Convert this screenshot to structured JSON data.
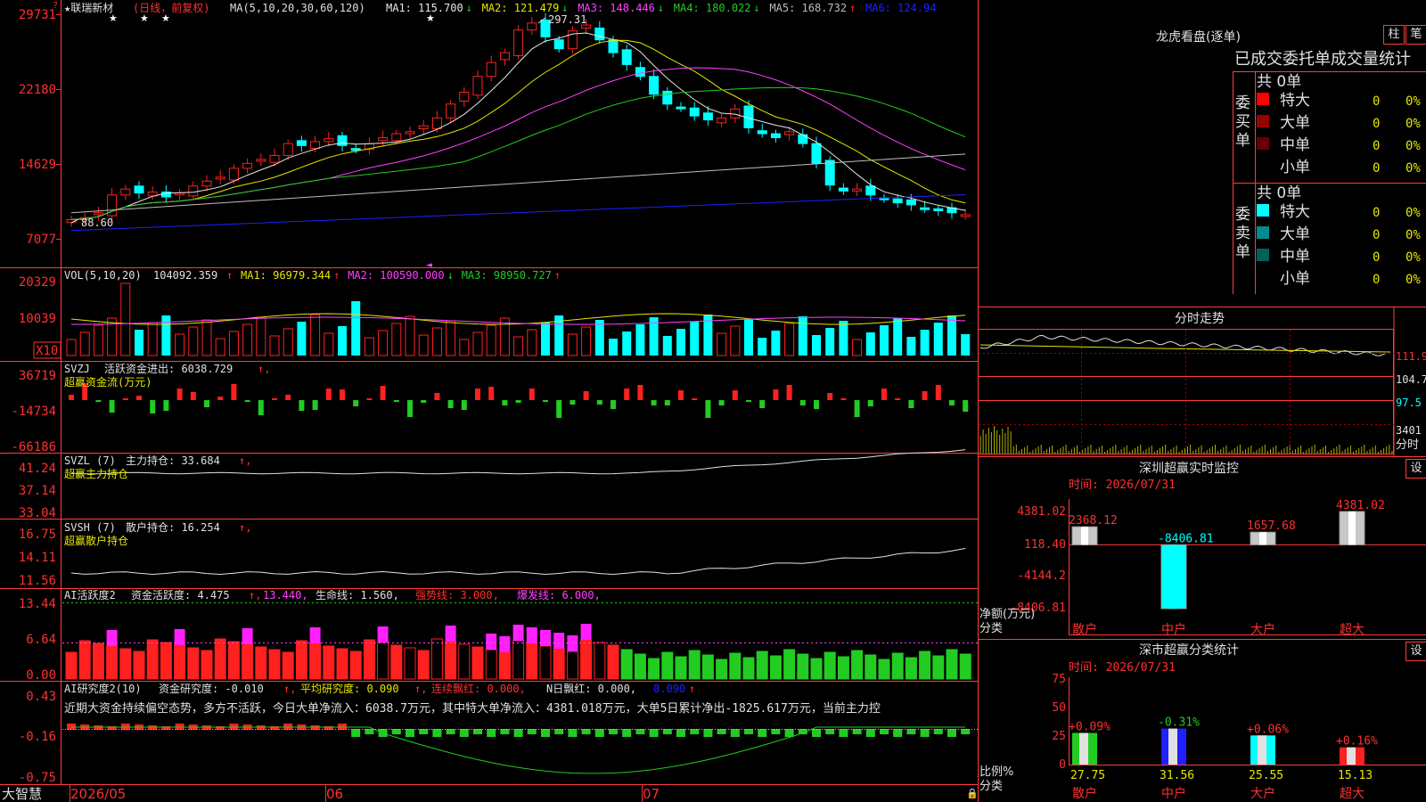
{
  "colors": {
    "up": "#ff2020",
    "down": "#00ffff",
    "grid": "#c00000",
    "axis": "#ff3c3c",
    "label_red": "#ff3030",
    "ma1": "#e6e6e6",
    "ma2": "#e6e600",
    "ma3": "#ff40ff",
    "ma4": "#22cc22",
    "ma5": "#bdbdbd",
    "ma6": "#2020ff"
  },
  "price_panel": {
    "axis_labels": [
      "29731",
      "22180",
      "14629",
      "7077"
    ],
    "markers": [
      "★",
      "★",
      "★",
      "★"
    ],
    "stock_name": "★联瑞新材",
    "period": "(日线，前复权)",
    "ma_title": "MA(5,10,20,30,60,120)",
    "ma_values": [
      {
        "label": "MA1: 115.700",
        "arrow": "↓",
        "color": "#e6e6e6"
      },
      {
        "label": "MA2: 121.479",
        "arrow": "↓",
        "color": "#e6e600"
      },
      {
        "label": "MA3: 148.446",
        "arrow": "↓",
        "color": "#ff40ff"
      },
      {
        "label": "MA4: 180.022",
        "arrow": "↓",
        "color": "#22cc22"
      },
      {
        "label": "MA5: 168.732",
        "arrow": "↑",
        "color": "#bdbdbd"
      },
      {
        "label": "MA6: 124.94",
        "arrow": "",
        "color": "#2020ff"
      }
    ],
    "high_label": "297.31",
    "low_label": "88.60"
  },
  "vol_panel": {
    "axis_labels": [
      "20329",
      "10039"
    ],
    "unit": "X10",
    "title": "VOL(5,10,20)",
    "value": "104092.359",
    "value_arrow": "↑",
    "items": [
      {
        "label": "MA1: 96979.344",
        "arrow": "↑",
        "color": "#e6e600"
      },
      {
        "label": "MA2: 100590.000",
        "arrow": "↓",
        "color": "#ff40ff"
      },
      {
        "label": "MA3: 98950.727",
        "arrow": "↑",
        "color": "#22cc22"
      }
    ]
  },
  "svzj_panel": {
    "axis_labels": [
      "36719",
      "-14734",
      "-66186"
    ],
    "title": "SVZJ",
    "line1": "活跃资金进出: 6038.729",
    "line1_arrow": "↑,",
    "line2": "超赢资金流(万元)"
  },
  "svzl_panel": {
    "axis_labels": [
      "41.24",
      "37.14",
      "33.04"
    ],
    "title": "SVZL (7)",
    "line1": "主力持仓: 33.684",
    "line1_arrow": "↑,",
    "line2": "超赢主力持仓"
  },
  "svsh_panel": {
    "axis_labels": [
      "16.75",
      "14.11",
      "11.56"
    ],
    "title": "SVSH (7)",
    "line1": "散户持仓: 16.254",
    "line1_arrow": "↑,",
    "line2": "超赢散户持仓"
  },
  "ai_panel": {
    "axis_labels": [
      "13.44",
      "6.64",
      "0.00"
    ],
    "title": "AI活跃度2",
    "label1": "资金活跃度: 4.475",
    "label1b": "13.440,",
    "label2": "生命线: 1.560,",
    "label3": "强势线: 3.000,",
    "label4": "爆发线: 6.000,"
  },
  "research_panel": {
    "axis_labels": [
      "0.43",
      "-0.16",
      "-0.75"
    ],
    "title": "AI研究度2(10)",
    "label1": "资金研究度: -0.010",
    "label2": "平均研究度: 0.090",
    "label3": "连续飘红: 0.000,",
    "label4": "N日飘红: 0.000,",
    "label5": "0.090",
    "commentary": "近期大资金持续偏空态势，多方不活跃，今日大单净流入：6038.7万元，其中特大单净流入：4381.018万元，大单5日累计净出-1825.617万元，当前主力控"
  },
  "date_axis": {
    "labels": [
      "2026/05",
      "06",
      "07"
    ],
    "brand": "大智慧"
  },
  "right_panel": {
    "dragon_title": "龙虎看盘(逐单)",
    "btn_pillar": "柱",
    "btn_stroke": "笔",
    "tabs_text": "已成交委托单成交量统计",
    "buy_group_label": "委买单",
    "sell_group_label": "委卖单",
    "buy_total": "共 0单",
    "sell_total": "共 0单",
    "buy_rows": [
      {
        "name": "特大",
        "count": "0",
        "pct": "0%",
        "color": "#ff0000"
      },
      {
        "name": "大单",
        "count": "0",
        "pct": "0%",
        "color": "#990000"
      },
      {
        "name": "中单",
        "count": "0",
        "pct": "0%",
        "color": "#660000"
      },
      {
        "name": "小单",
        "count": "0",
        "pct": "0%",
        "color": "#000000"
      }
    ],
    "sell_rows": [
      {
        "name": "特大",
        "count": "0",
        "pct": "0%",
        "color": "#00ffff"
      },
      {
        "name": "大单",
        "count": "0",
        "pct": "0%",
        "color": "#008c8c"
      },
      {
        "name": "中单",
        "count": "0",
        "pct": "0%",
        "color": "#006060"
      },
      {
        "name": "小单",
        "count": "0",
        "pct": "0%",
        "color": "#000000"
      }
    ],
    "intraday_title": "分时走势",
    "intraday_labels": [
      "111.9",
      "104.7",
      "97.5",
      "3401",
      "分时"
    ],
    "monitor_title": "深圳超赢实时监控",
    "monitor_btn": "设",
    "monitor_time": "时间: 2026/07/31",
    "monitor_axis": [
      "4381.02",
      "118.40",
      "-4144.2",
      "-8406.81"
    ],
    "monitor_ylabel": [
      "净额(万元)",
      "分类"
    ],
    "monitor_bars": [
      {
        "name": "散户",
        "value": 2368.12,
        "label": "2368.12",
        "color": "#c8c8c8"
      },
      {
        "name": "中户",
        "value": -8406.81,
        "label": "-8406.81",
        "color": "#00ffff"
      },
      {
        "name": "大户",
        "value": 1657.68,
        "label": "1657.68",
        "color": "#c8c8c8"
      },
      {
        "name": "超大",
        "value": 4381.02,
        "label": "4381.02",
        "color": "#c8c8c8"
      }
    ],
    "class_title": "深市超赢分类统计",
    "class_btn": "设",
    "class_time": "时间: 2026/07/31",
    "class_axis": [
      "75",
      "50",
      "25",
      "0"
    ],
    "class_ylabel": [
      "比例%",
      "分类"
    ],
    "class_bars": [
      {
        "name": "散户",
        "value": 27.75,
        "label": "27.75",
        "change": "+0.09%",
        "color": "#22cc22",
        "change_color": "#ff3030"
      },
      {
        "name": "中户",
        "value": 31.56,
        "label": "31.56",
        "change": "-0.31%",
        "color": "#2020ff",
        "change_color": "#22cc22"
      },
      {
        "name": "大户",
        "value": 25.55,
        "label": "25.55",
        "change": "+0.06%",
        "color": "#00ffff",
        "change_color": "#ff3030"
      },
      {
        "name": "超大",
        "value": 15.13,
        "label": "15.13",
        "change": "+0.16%",
        "color": "#ff2020",
        "change_color": "#ff3030"
      }
    ]
  }
}
